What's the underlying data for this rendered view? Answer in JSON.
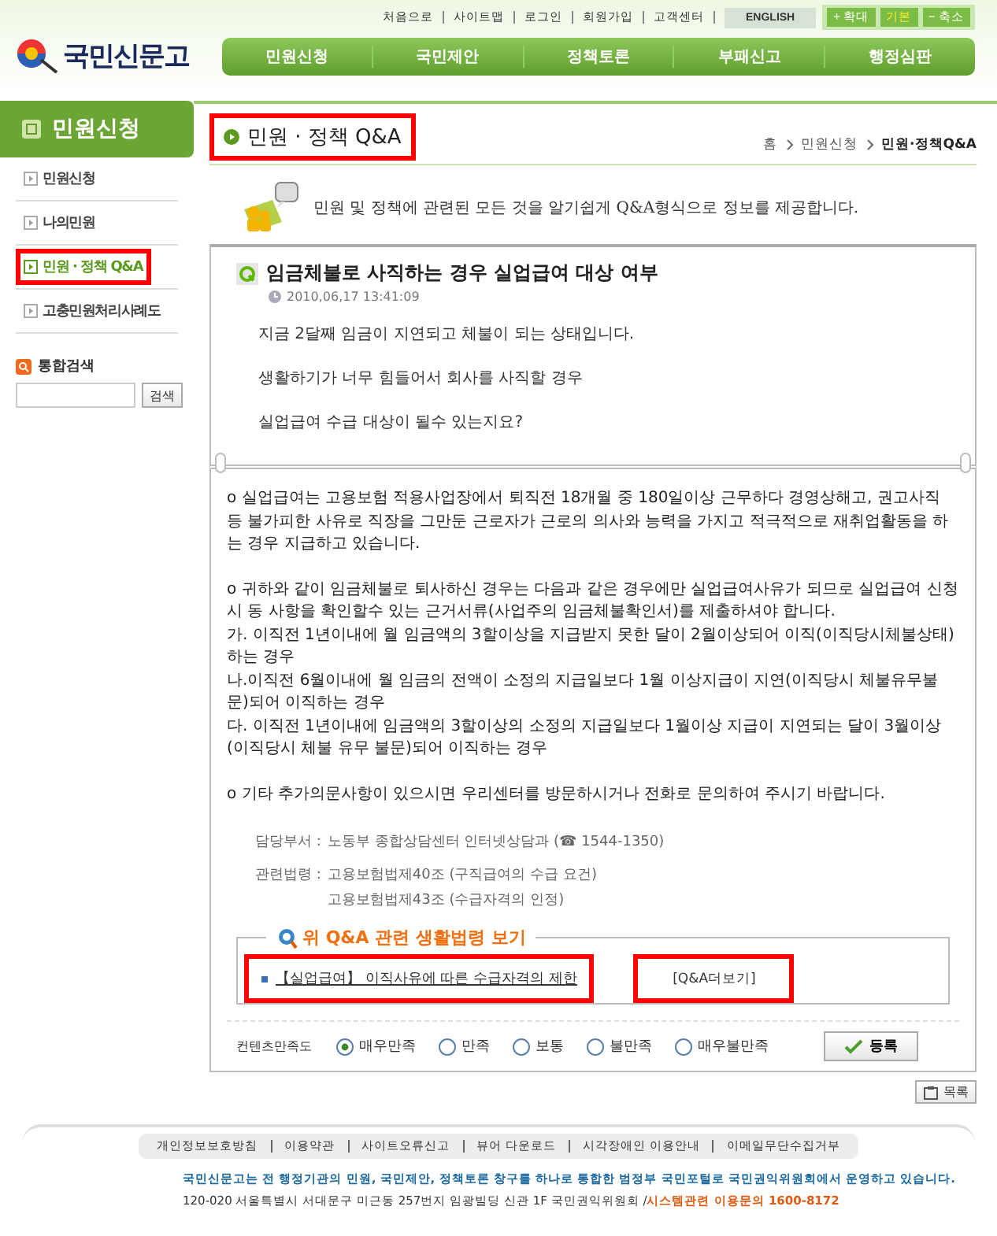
{
  "top_links": [
    "처음으로",
    "사이트맵",
    "로그인",
    "회원가입",
    "고객센터"
  ],
  "english": "ENGLISH",
  "zoom_buttons": [
    {
      "label": "+ 확대",
      "selected": false
    },
    {
      "label": "기본",
      "selected": true
    },
    {
      "label": "− 축소",
      "selected": false
    }
  ],
  "logo": "국민신문고",
  "nav": [
    "민원신청",
    "국민제안",
    "정책토론",
    "부패신고",
    "행정심판"
  ],
  "sidebar": {
    "title": "민원신청",
    "items": [
      {
        "label": "민원신청",
        "selected": false,
        "highlighted": false
      },
      {
        "label": "나의민원",
        "selected": false,
        "highlighted": false
      },
      {
        "label": "민원 · 정책 Q&A",
        "selected": true,
        "highlighted": true
      },
      {
        "label": "고충민원처리사례도",
        "selected": false,
        "highlighted": false
      }
    ],
    "search": {
      "label": "통합검색",
      "button": "검색"
    }
  },
  "page_title": {
    "text": "민원 · 정책 Q&A",
    "highlighted": true
  },
  "breadcrumb": [
    "홈",
    "민원신청",
    "민원·정책Q&A"
  ],
  "intro": "민원 및 정책에 관련된 모든 것을 알기쉽게 Q&A형식으로 정보를 제공합니다.",
  "question": {
    "title": "임금체불로 사직하는 경우 실업급여 대상 여부",
    "date": "2010,06,17 13:41:09",
    "body": [
      "지금 2달째 임금이 지연되고 체불이 되는 상태입니다.",
      "생활하기가 너무 힘들어서 회사를 사직할 경우",
      "실업급여 수급 대상이 될수 있는지요?"
    ]
  },
  "answer": [
    [
      "o 실업급여는 고용보험 적용사업장에서 퇴직전 18개월 중 180일이상 근무하다 경영상해고, 권고사직 등 불가피한 사유로 직장을 그만둔 근로자가 근로의 의사와 능력을 가지고 적극적으로 재취업활동을 하는 경우 지급하고 있습니다."
    ],
    [
      "o 귀하와 같이 임금체불로 퇴사하신 경우는 다음과 같은 경우에만 실업급여사유가 되므로 실업급여 신청시 동 사항을 확인할수 있는 근거서류(사업주의 임금체불확인서)를 제출하셔야 합니다.",
      "가. 이직전 1년이내에 월 임금액의 3할이상을 지급받지 못한 달이 2월이상되어 이직(이직당시체불상태)하는 경우",
      "나.이직전 6월이내에 월 임금의 전액이 소정의 지급일보다 1월 이상지급이 지연(이직당시 체불유무불문)되어 이직하는 경우",
      "다. 이직전 1년이내에 임금액의 3할이상의 소정의 지급일보다 1월이상 지급이 지연되는 달이 3월이상(이직당시 체불 유무 불문)되어 이직하는 경우"
    ],
    [
      "o 기타 추가의문사항이 있으시면 우리센터를 방문하시거나 전화로 문의하여 주시기 바랍니다."
    ]
  ],
  "dept": {
    "label": "담당부서 :",
    "value": "노동부 종합상담센터 인터넷상담과 (☎ 1544-1350)"
  },
  "laws": {
    "label": "관련법령 :",
    "items": [
      "고용보험법제40조 (구직급여의 수급 요건)",
      "고용보험법제43조 (수급자격의 인정)"
    ]
  },
  "related": {
    "title": "위 Q&A 관련 생활법령 보기",
    "link": {
      "text": "【실업급여】 이직사유에 따른 수급자격의 제한",
      "highlighted": true
    },
    "more": {
      "text": "[Q&A더보기]",
      "highlighted": true
    }
  },
  "rating": {
    "label": "컨텐츠만족도",
    "options": [
      {
        "label": "매우만족",
        "selected": true
      },
      {
        "label": "만족",
        "selected": false
      },
      {
        "label": "보통",
        "selected": false
      },
      {
        "label": "불만족",
        "selected": false
      },
      {
        "label": "매우불만족",
        "selected": false
      }
    ],
    "button": "등록"
  },
  "list_button": "목록",
  "footer": {
    "links": [
      "개인정보보호방침",
      "이용약관",
      "사이트오류신고",
      "뷰어 다운로드",
      "시각장애인 이용안내",
      "이메일무단수집거부"
    ],
    "notice": "국민신문고는 전 행정기관의 민원, 국민제안, 정책토론 창구를 하나로 통합한 범정부 국민포털로 국민권익위원회에서 운영하고 있습니다.",
    "address": "120-020 서울특별시 서대문구 미근동 257번지 임광빌딩 신관 1F  국민권익위원회 /",
    "contact": "시스템관련 이용문의 1600-8172"
  }
}
